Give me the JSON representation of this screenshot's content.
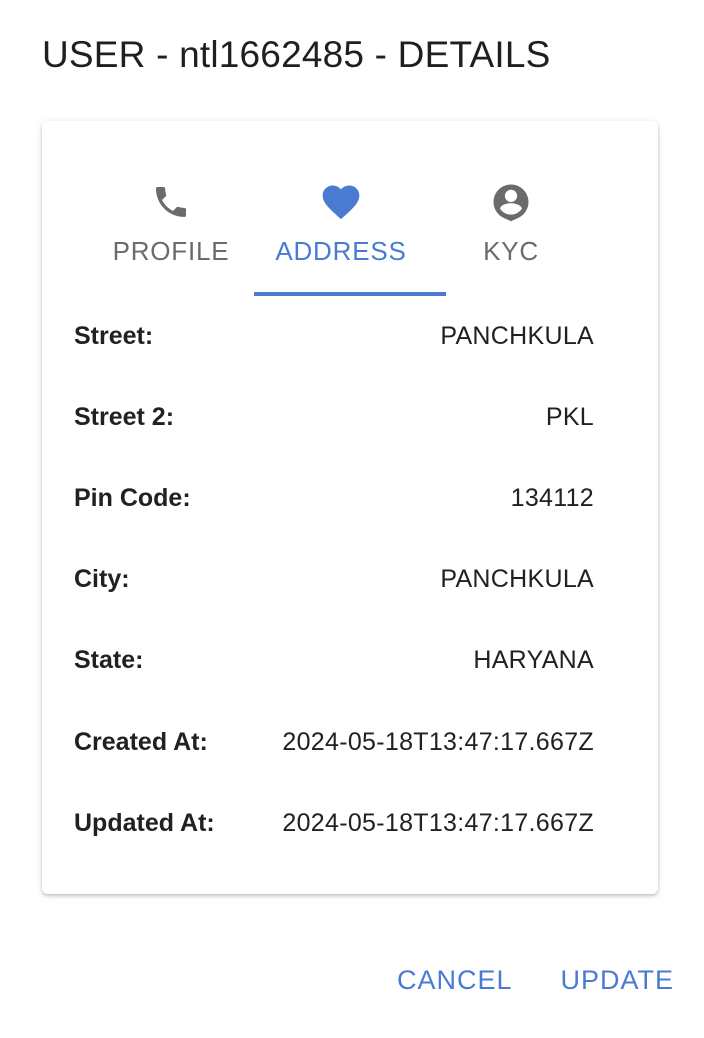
{
  "dialog": {
    "title": "USER - ntl1662485 - DETAILS"
  },
  "tabs": [
    {
      "label": "PROFILE",
      "icon": "phone-icon",
      "active": false
    },
    {
      "label": "ADDRESS",
      "icon": "heart-icon",
      "active": true
    },
    {
      "label": "KYC",
      "icon": "account-circle-icon",
      "active": false
    }
  ],
  "address": {
    "street_label": "Street:",
    "street": "PANCHKULA",
    "street2_label": "Street 2:",
    "street2": "PKL",
    "pincode_label": "Pin Code:",
    "pincode": "134112",
    "city_label": "City:",
    "city": "PANCHKULA",
    "state_label": "State:",
    "state": "HARYANA",
    "created_label": "Created At:",
    "created": "2024-05-18T13:47:17.667Z",
    "updated_label": "Updated At:",
    "updated": "2024-05-18T13:47:17.667Z"
  },
  "actions": {
    "cancel_label": "CANCEL",
    "update_label": "UPDATE"
  },
  "colors": {
    "accent": "#4a7bd0",
    "tab_inactive": "#6b6b6b",
    "text": "#212121"
  }
}
